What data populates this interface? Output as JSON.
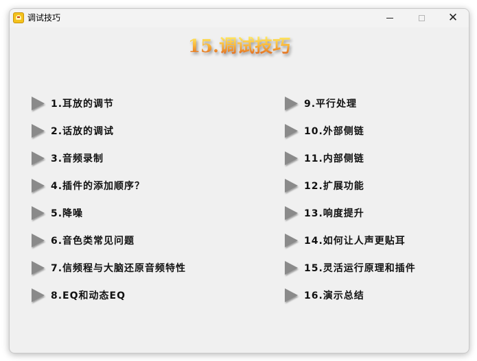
{
  "window": {
    "title": "调试技巧",
    "banner": "15.调试技巧"
  },
  "menu": {
    "left": [
      {
        "label": "1.耳放的调节"
      },
      {
        "label": "2.话放的调试"
      },
      {
        "label": "3.音频录制"
      },
      {
        "label": "4.插件的添加顺序？"
      },
      {
        "label": "5.降噪"
      },
      {
        "label": "6.音色类常见问题"
      },
      {
        "label": "7.信频程与大脑还原音频特性"
      },
      {
        "label": "8.EQ和动态EQ"
      }
    ],
    "right": [
      {
        "label": "9.平行处理"
      },
      {
        "label": "10.外部侧链"
      },
      {
        "label": "11.内部侧链"
      },
      {
        "label": "12.扩展功能"
      },
      {
        "label": "13.响度提升"
      },
      {
        "label": "14.如何让人声更贴耳"
      },
      {
        "label": "15.灵活运行原理和插件"
      },
      {
        "label": "16.演示总结"
      }
    ]
  },
  "icons": {
    "app": "app-icon",
    "item": "play-arrow-icon"
  }
}
